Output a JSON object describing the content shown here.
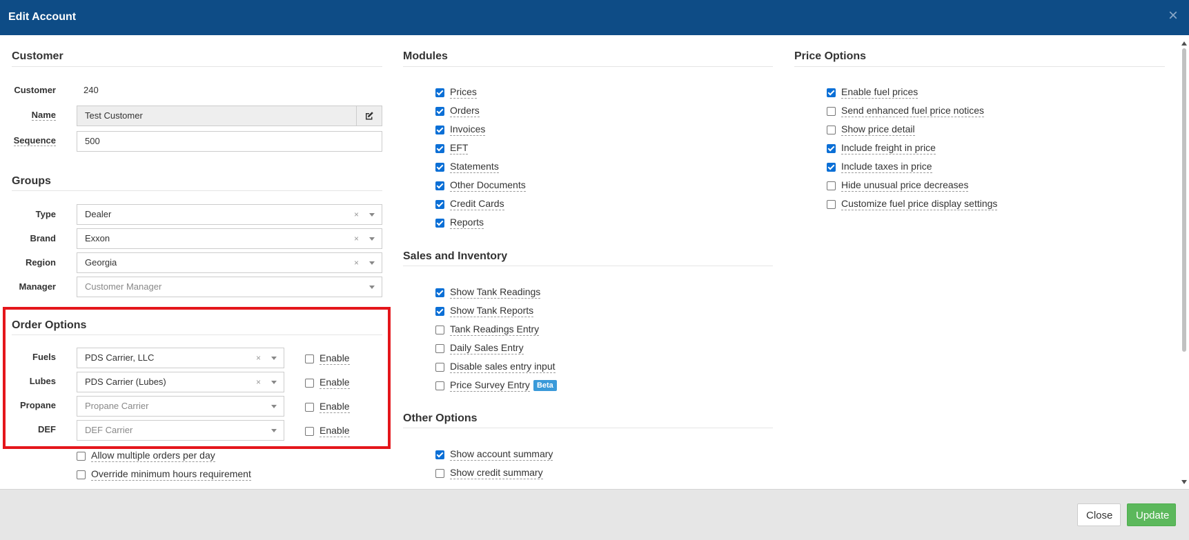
{
  "header": {
    "title": "Edit Account",
    "close_icon": "×"
  },
  "customer": {
    "title": "Customer",
    "id_label": "Customer",
    "id_value": "240",
    "name_label": "Name",
    "name_value": "Test Customer",
    "sequence_label": "Sequence",
    "sequence_value": "500"
  },
  "groups": {
    "title": "Groups",
    "type_label": "Type",
    "type_value": "Dealer",
    "brand_label": "Brand",
    "brand_value": "Exxon",
    "region_label": "Region",
    "region_value": "Georgia",
    "manager_label": "Manager",
    "manager_placeholder": "Customer Manager",
    "clear_glyph": "×"
  },
  "order_options": {
    "title": "Order Options",
    "fuels_label": "Fuels",
    "fuels_value": "PDS Carrier, LLC",
    "lubes_label": "Lubes",
    "lubes_value": "PDS Carrier (Lubes)",
    "propane_label": "Propane",
    "propane_placeholder": "Propane Carrier",
    "def_label": "DEF",
    "def_placeholder": "DEF Carrier",
    "enable_label": "Enable",
    "allow_multiple": "Allow multiple orders per day",
    "override_min": "Override minimum hours requirement"
  },
  "modules": {
    "title": "Modules",
    "items": [
      {
        "label": "Prices",
        "checked": true
      },
      {
        "label": "Orders",
        "checked": true
      },
      {
        "label": "Invoices",
        "checked": true
      },
      {
        "label": "EFT",
        "checked": true
      },
      {
        "label": "Statements",
        "checked": true
      },
      {
        "label": "Other Documents",
        "checked": true
      },
      {
        "label": "Credit Cards",
        "checked": true
      },
      {
        "label": "Reports",
        "checked": true
      }
    ]
  },
  "sales_inventory": {
    "title": "Sales and Inventory",
    "items": [
      {
        "label": "Show Tank Readings",
        "checked": true
      },
      {
        "label": "Show Tank Reports",
        "checked": true
      },
      {
        "label": "Tank Readings Entry",
        "checked": false
      },
      {
        "label": "Daily Sales Entry",
        "checked": false
      },
      {
        "label": "Disable sales entry input",
        "checked": false
      },
      {
        "label": "Price Survey Entry",
        "checked": false
      }
    ],
    "beta_badge": "Beta"
  },
  "other_options": {
    "title": "Other Options",
    "items": [
      {
        "label": "Show account summary",
        "checked": true
      },
      {
        "label": "Show credit summary",
        "checked": false
      }
    ]
  },
  "price_options": {
    "title": "Price Options",
    "items": [
      {
        "label": "Enable fuel prices",
        "checked": true
      },
      {
        "label": "Send enhanced fuel price notices",
        "checked": false
      },
      {
        "label": "Show price detail",
        "checked": false
      },
      {
        "label": "Include freight in price",
        "checked": true
      },
      {
        "label": "Include taxes in price",
        "checked": true
      },
      {
        "label": "Hide unusual price decreases",
        "checked": false
      },
      {
        "label": "Customize fuel price display settings",
        "checked": false
      }
    ]
  },
  "footer": {
    "close_label": "Close",
    "update_label": "Update"
  },
  "colors": {
    "header": "#0e4c86",
    "checkbox": "#0b6fd6",
    "highlight": "#e4161b",
    "update": "#5cb85c",
    "beta": "#3a9ad9"
  }
}
